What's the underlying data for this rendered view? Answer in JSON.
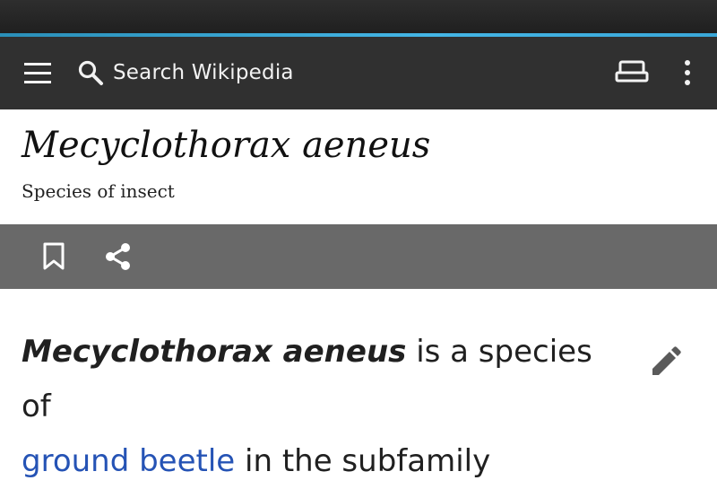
{
  "search": {
    "placeholder": "Search Wikipedia"
  },
  "article": {
    "title": "Mecyclothorax aeneus",
    "subtitle": "Species of insect",
    "lead": {
      "bold_term": "Mecyclothorax aeneus",
      "text_1": " is a species of ",
      "link_text": "ground beetle",
      "text_2": " in the subfamily"
    }
  },
  "icons": {
    "menu": "hamburger-menu-icon",
    "search": "search-icon",
    "reading_list": "reading-list-icon",
    "overflow": "more-vert-icon",
    "bookmark": "bookmark-icon",
    "share": "share-icon",
    "edit": "pencil-icon"
  },
  "colors": {
    "toolbar": "#303030",
    "accent": "#44b6e6",
    "action_bar": "#696969",
    "link": "#2553b5"
  }
}
